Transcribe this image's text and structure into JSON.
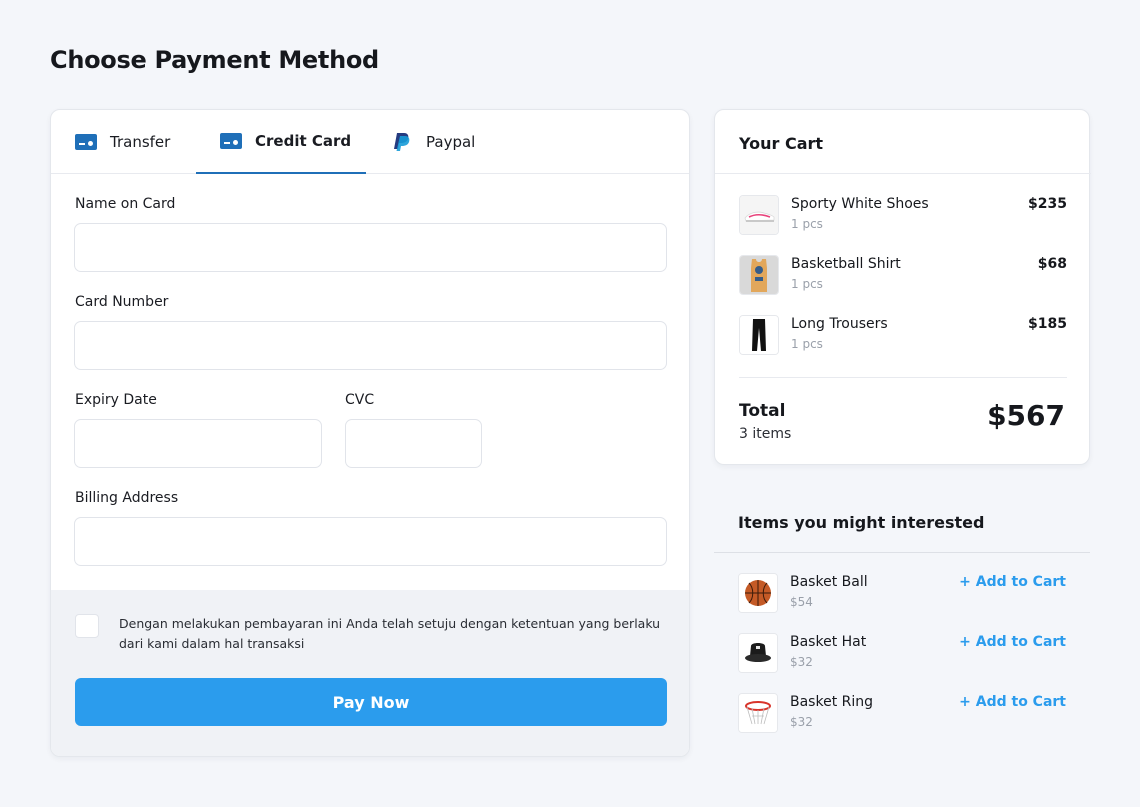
{
  "page_title": "Choose Payment Method",
  "tabs": [
    {
      "label": "Transfer",
      "icon": "transfer-card-icon"
    },
    {
      "label": "Credit Card",
      "icon": "credit-card-icon",
      "active": true
    },
    {
      "label": "Paypal",
      "icon": "paypal-icon"
    }
  ],
  "form": {
    "name_label": "Name on Card",
    "name_value": "",
    "card_number_label": "Card Number",
    "card_number_value": "",
    "expiry_label": "Expiry Date",
    "expiry_value": "",
    "cvc_label": "CVC",
    "cvc_value": "",
    "billing_label": "Billing Address",
    "billing_value": ""
  },
  "terms": {
    "checked": false,
    "text": "Dengan melakukan pembayaran ini Anda telah setuju dengan ketentuan yang berlaku dari kami dalam hal transaksi"
  },
  "pay_button": "Pay Now",
  "cart": {
    "title": "Your Cart",
    "items": [
      {
        "name": "Sporty White Shoes",
        "qty": "1 pcs",
        "price": "$235",
        "thumb": "shoe-thumbnail"
      },
      {
        "name": "Basketball Shirt",
        "qty": "1 pcs",
        "price": "$68",
        "thumb": "jersey-thumbnail"
      },
      {
        "name": "Long Trousers",
        "qty": "1 pcs",
        "price": "$185",
        "thumb": "trousers-thumbnail"
      }
    ],
    "total_label": "Total",
    "total_count": "3 items",
    "total_value": "$567"
  },
  "suggestions": {
    "title": "Items you might interested",
    "add_label": "+ Add to Cart",
    "items": [
      {
        "name": "Basket Ball",
        "price": "$54",
        "thumb": "basketball-thumbnail"
      },
      {
        "name": "Basket Hat",
        "price": "$32",
        "thumb": "bucket-hat-thumbnail"
      },
      {
        "name": "Basket Ring",
        "price": "$32",
        "thumb": "hoop-thumbnail"
      }
    ]
  },
  "colors": {
    "accent": "#2b9ced",
    "tab_active": "#1f6fb8",
    "background": "#f4f6fa"
  }
}
